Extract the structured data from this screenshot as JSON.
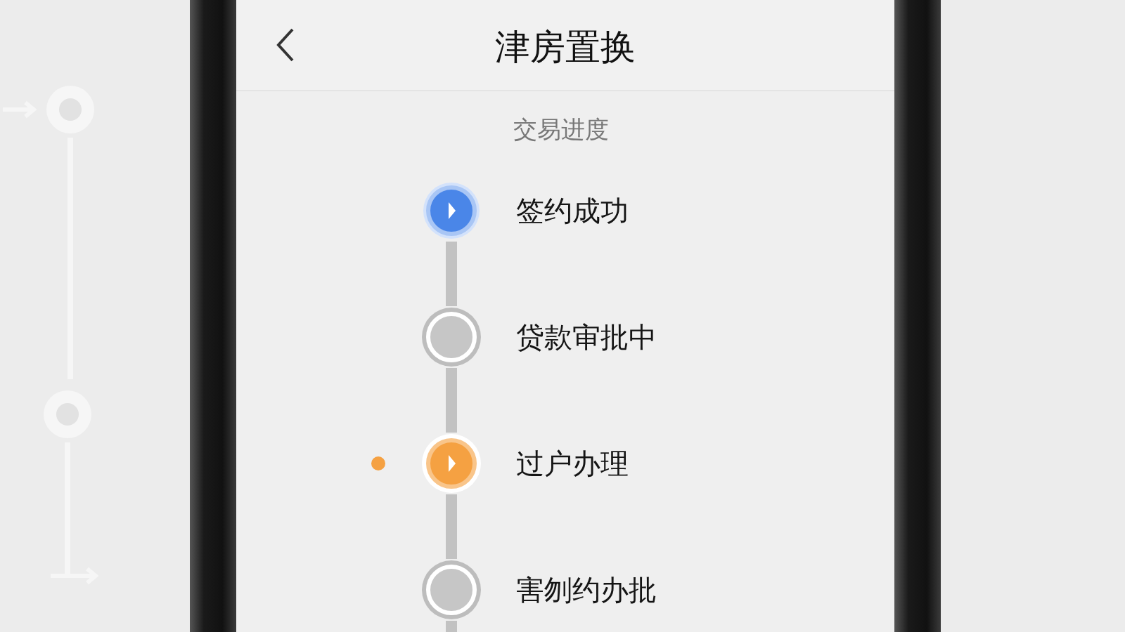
{
  "header": {
    "title": "津房置换"
  },
  "section": {
    "title": "交易进度"
  },
  "steps": [
    {
      "label": "签约成功",
      "kind": "done"
    },
    {
      "label": "贷款审批中",
      "kind": "pending"
    },
    {
      "label": "过户办理",
      "kind": "current"
    },
    {
      "label": "害刎约办批",
      "kind": "pending"
    }
  ]
}
